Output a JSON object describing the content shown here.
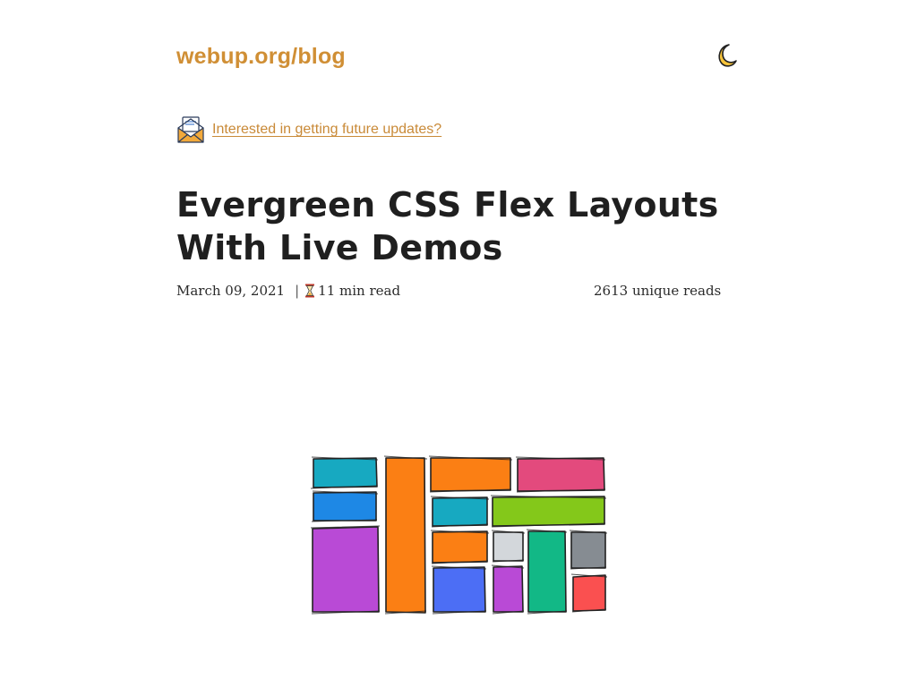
{
  "header": {
    "site_title": "webup.org/blog",
    "theme_toggle_icon": "crescent-moon-icon"
  },
  "newsletter": {
    "icon": "envelope-letter-icon",
    "link_text": "Interested in getting future updates?"
  },
  "post": {
    "title": "Evergreen CSS Flex Layouts With Live Demos",
    "date": "March 09, 2021",
    "separator": "|",
    "reading_time_icon": "hourglass-icon",
    "reading_time": "11 min read",
    "unique_reads": "2613 unique reads"
  },
  "hero_image": {
    "description_icon": "flex-layout-boxes-illustration",
    "box_colors": [
      "#17a9c1",
      "#1e88e5",
      "#b94ad6",
      "#fb7f14",
      "#e34a7d",
      "#84c81a",
      "#d3d7db",
      "#12b886",
      "#868c92",
      "#4c6ef5",
      "#fa5050"
    ]
  },
  "colors": {
    "accent": "#d08f35",
    "text": "#1f1f1f"
  }
}
